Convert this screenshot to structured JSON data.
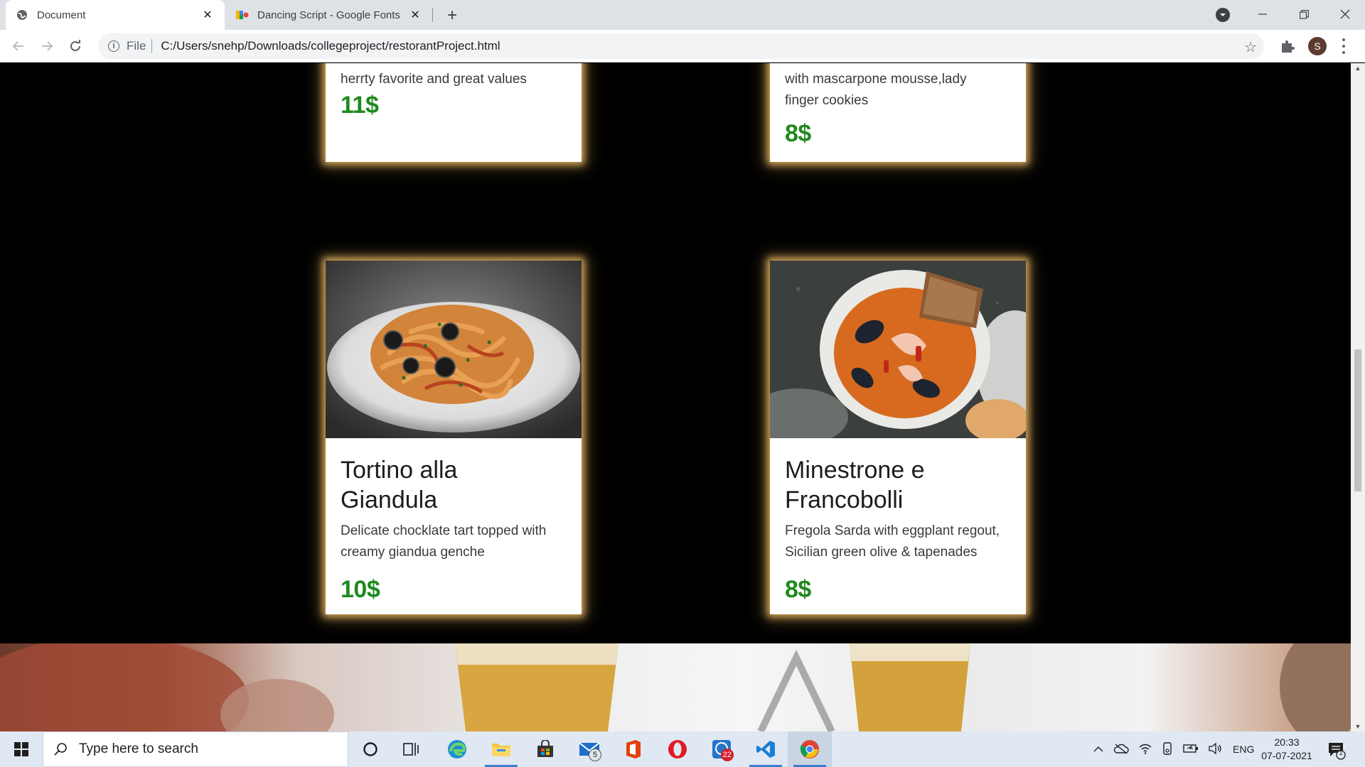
{
  "browser": {
    "tabs": [
      {
        "title": "Document",
        "active": true
      },
      {
        "title": "Dancing Script - Google Fonts",
        "active": false
      }
    ],
    "address": {
      "scheme": "File",
      "url": "C:/Users/snehp/Downloads/collegeproject/restorantProject.html"
    },
    "profile_initial": "S"
  },
  "menu": {
    "top_cards": [
      {
        "desc_lines": [
          "herrty favorite and great values"
        ],
        "price": "11$"
      },
      {
        "desc_lines": [
          "with mascarpone mousse,lady",
          "finger cookies"
        ],
        "price": "8$"
      }
    ],
    "cards": [
      {
        "image": "pasta-dish",
        "title_lines": [
          "Tortino alla",
          "Giandula"
        ],
        "desc_lines": [
          "Delicate chocklate tart topped with",
          "creamy giandua genche"
        ],
        "price": "10$"
      },
      {
        "image": "seafood-stew",
        "title_lines": [
          "Minestrone e",
          "Francobolli"
        ],
        "desc_lines": [
          "Fregola Sarda with eggplant regout,",
          "Sicilian green olive & tapenades"
        ],
        "price": "8$"
      }
    ]
  },
  "taskbar": {
    "search_placeholder": "Type here to search",
    "mail_badge": "5",
    "whatsapp_badge": "22",
    "language": "ENG",
    "time": "20:33",
    "date": "07-07-2021",
    "notification_count": "1"
  },
  "colors": {
    "price": "#1f8a1f",
    "card_glow": "#d6a85a",
    "page_background": "#000000"
  }
}
